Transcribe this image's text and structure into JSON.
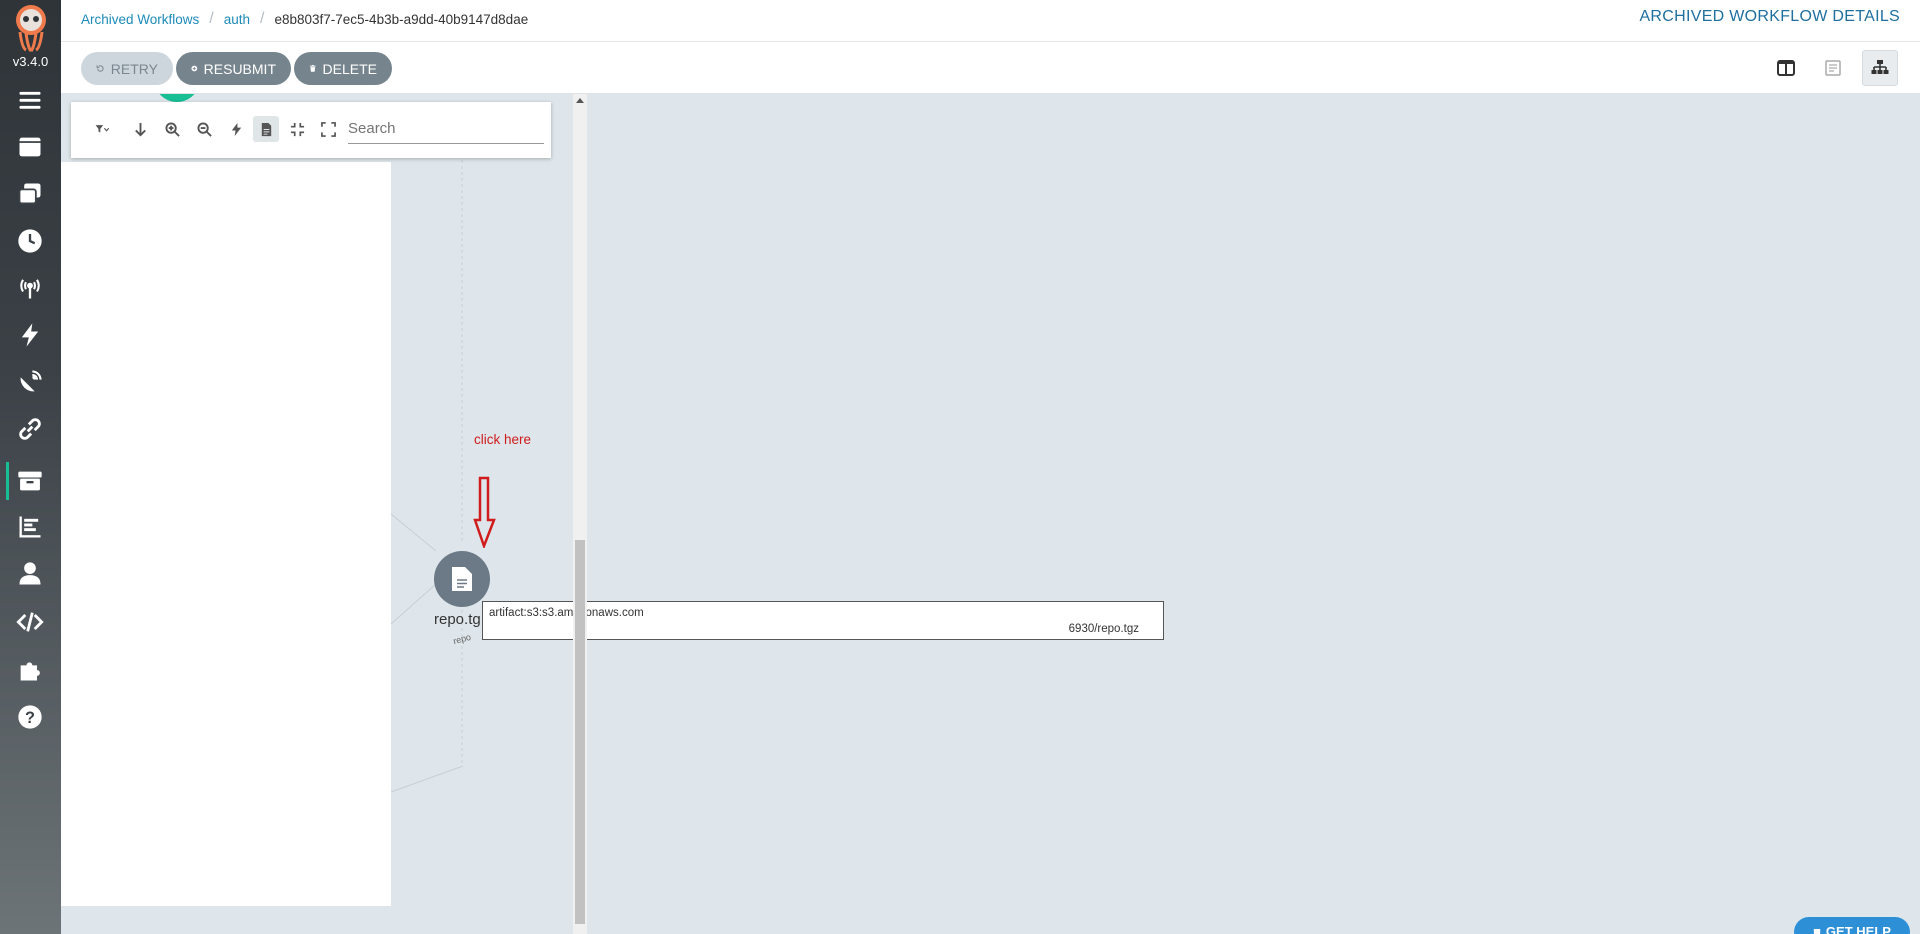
{
  "sidebar": {
    "version": "v3.4.0",
    "items": [
      {
        "name": "menu",
        "icon": "hamburger-icon"
      },
      {
        "name": "workflows",
        "icon": "stream-icon"
      },
      {
        "name": "workflow-templates",
        "icon": "window-restore-icon"
      },
      {
        "name": "cron-workflows",
        "icon": "clock-icon"
      },
      {
        "name": "event-sources",
        "icon": "broadcast-tower-icon"
      },
      {
        "name": "sensors",
        "icon": "bolt-icon"
      },
      {
        "name": "event-flow",
        "icon": "satellite-dish-icon"
      },
      {
        "name": "workflow-event-bindings",
        "icon": "link-icon"
      },
      {
        "name": "archived-workflows",
        "icon": "archive-icon",
        "active": true
      },
      {
        "name": "reports",
        "icon": "chart-bar-icon"
      },
      {
        "name": "user",
        "icon": "user-icon"
      },
      {
        "name": "api-docs",
        "icon": "code-icon"
      },
      {
        "name": "plugins",
        "icon": "puzzle-piece-icon"
      },
      {
        "name": "help",
        "icon": "question-circle-icon"
      }
    ]
  },
  "header": {
    "breadcrumb": [
      "Archived Workflows",
      "auth",
      "e8b803f7-7ec5-4b3b-a9dd-40b9147d8dae"
    ],
    "title": "ARCHIVED WORKFLOW DETAILS"
  },
  "toolbar": {
    "retry_label": "RETRY",
    "resubmit_label": "RESUBMIT",
    "delete_label": "DELETE"
  },
  "graph": {
    "search_placeholder": "Search",
    "annotation": "click here",
    "node_label": "repo.tg",
    "node_sublabel": "repo",
    "tooltip_line1": "artifact:s3:s3.amazonaws.com",
    "tooltip_line2": "6930/repo.tgz"
  },
  "help_button": "GET HELP",
  "colors": {
    "accent": "#18be94",
    "link": "#1d8bb8",
    "button": "#76848e",
    "annotation": "#d01c1c"
  }
}
